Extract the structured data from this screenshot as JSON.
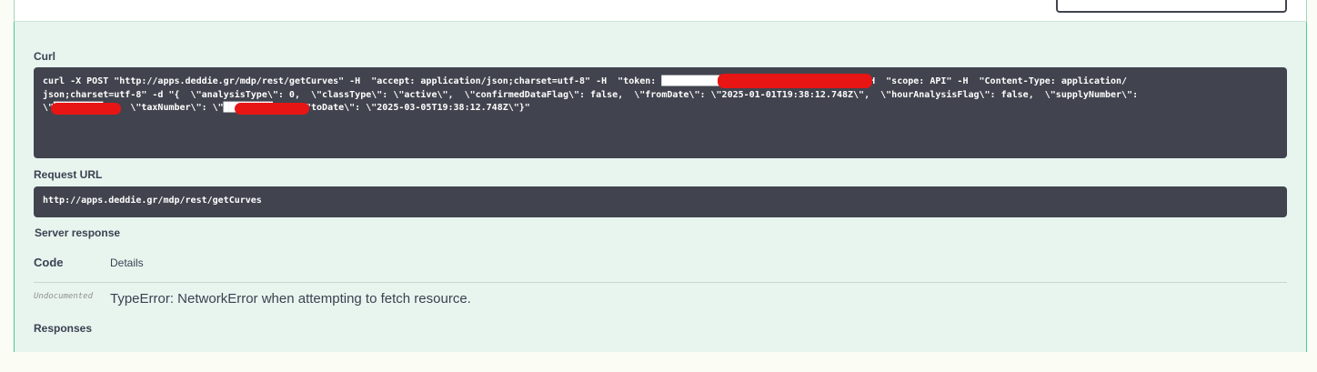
{
  "sections": {
    "curl_label": "Curl",
    "request_url_label": "Request URL",
    "server_response_label": "Server response",
    "responses_label": "Responses"
  },
  "curl": {
    "line1": "curl -X POST \"http://apps.deddie.gr/mdp/rest/getCurves\" -H  \"accept: application/json;charset=utf-8\" -H  \"token: ████████████████████1491cfde1b4c5ce\" -H  \"scope: API\" -H  \"Content-Type: application/",
    "line2": "json;charset=utf-8\" -d \"{  \\\"analysisType\\\": 0,  \\\"classType\\\": \\\"active\\\",  \\\"confirmedDataFlag\\\": false,  \\\"fromDate\\\": \\\"2025-01-01T19:38:12.748Z\\\",  \\\"hourAnalysisFlag\\\": false,  \\\"supplyNumber\\\":",
    "line3": "\\\"█████████\\\",  \\\"taxNumber\\\": \\\"█████████\\\",  \\\"toDate\\\": \\\"2025-03-05T19:38:12.748Z\\\"}\""
  },
  "request_url": "http://apps.deddie.gr/mdp/rest/getCurves",
  "response_table": {
    "code_header": "Code",
    "details_header": "Details",
    "rows": [
      {
        "code": "Undocumented",
        "details": "TypeError: NetworkError when attempting to fetch resource."
      }
    ]
  },
  "colors": {
    "panel_bg": "#e8f5ef",
    "panel_border": "#49cc90",
    "code_bg": "#41444e",
    "redaction": "#e81515"
  }
}
